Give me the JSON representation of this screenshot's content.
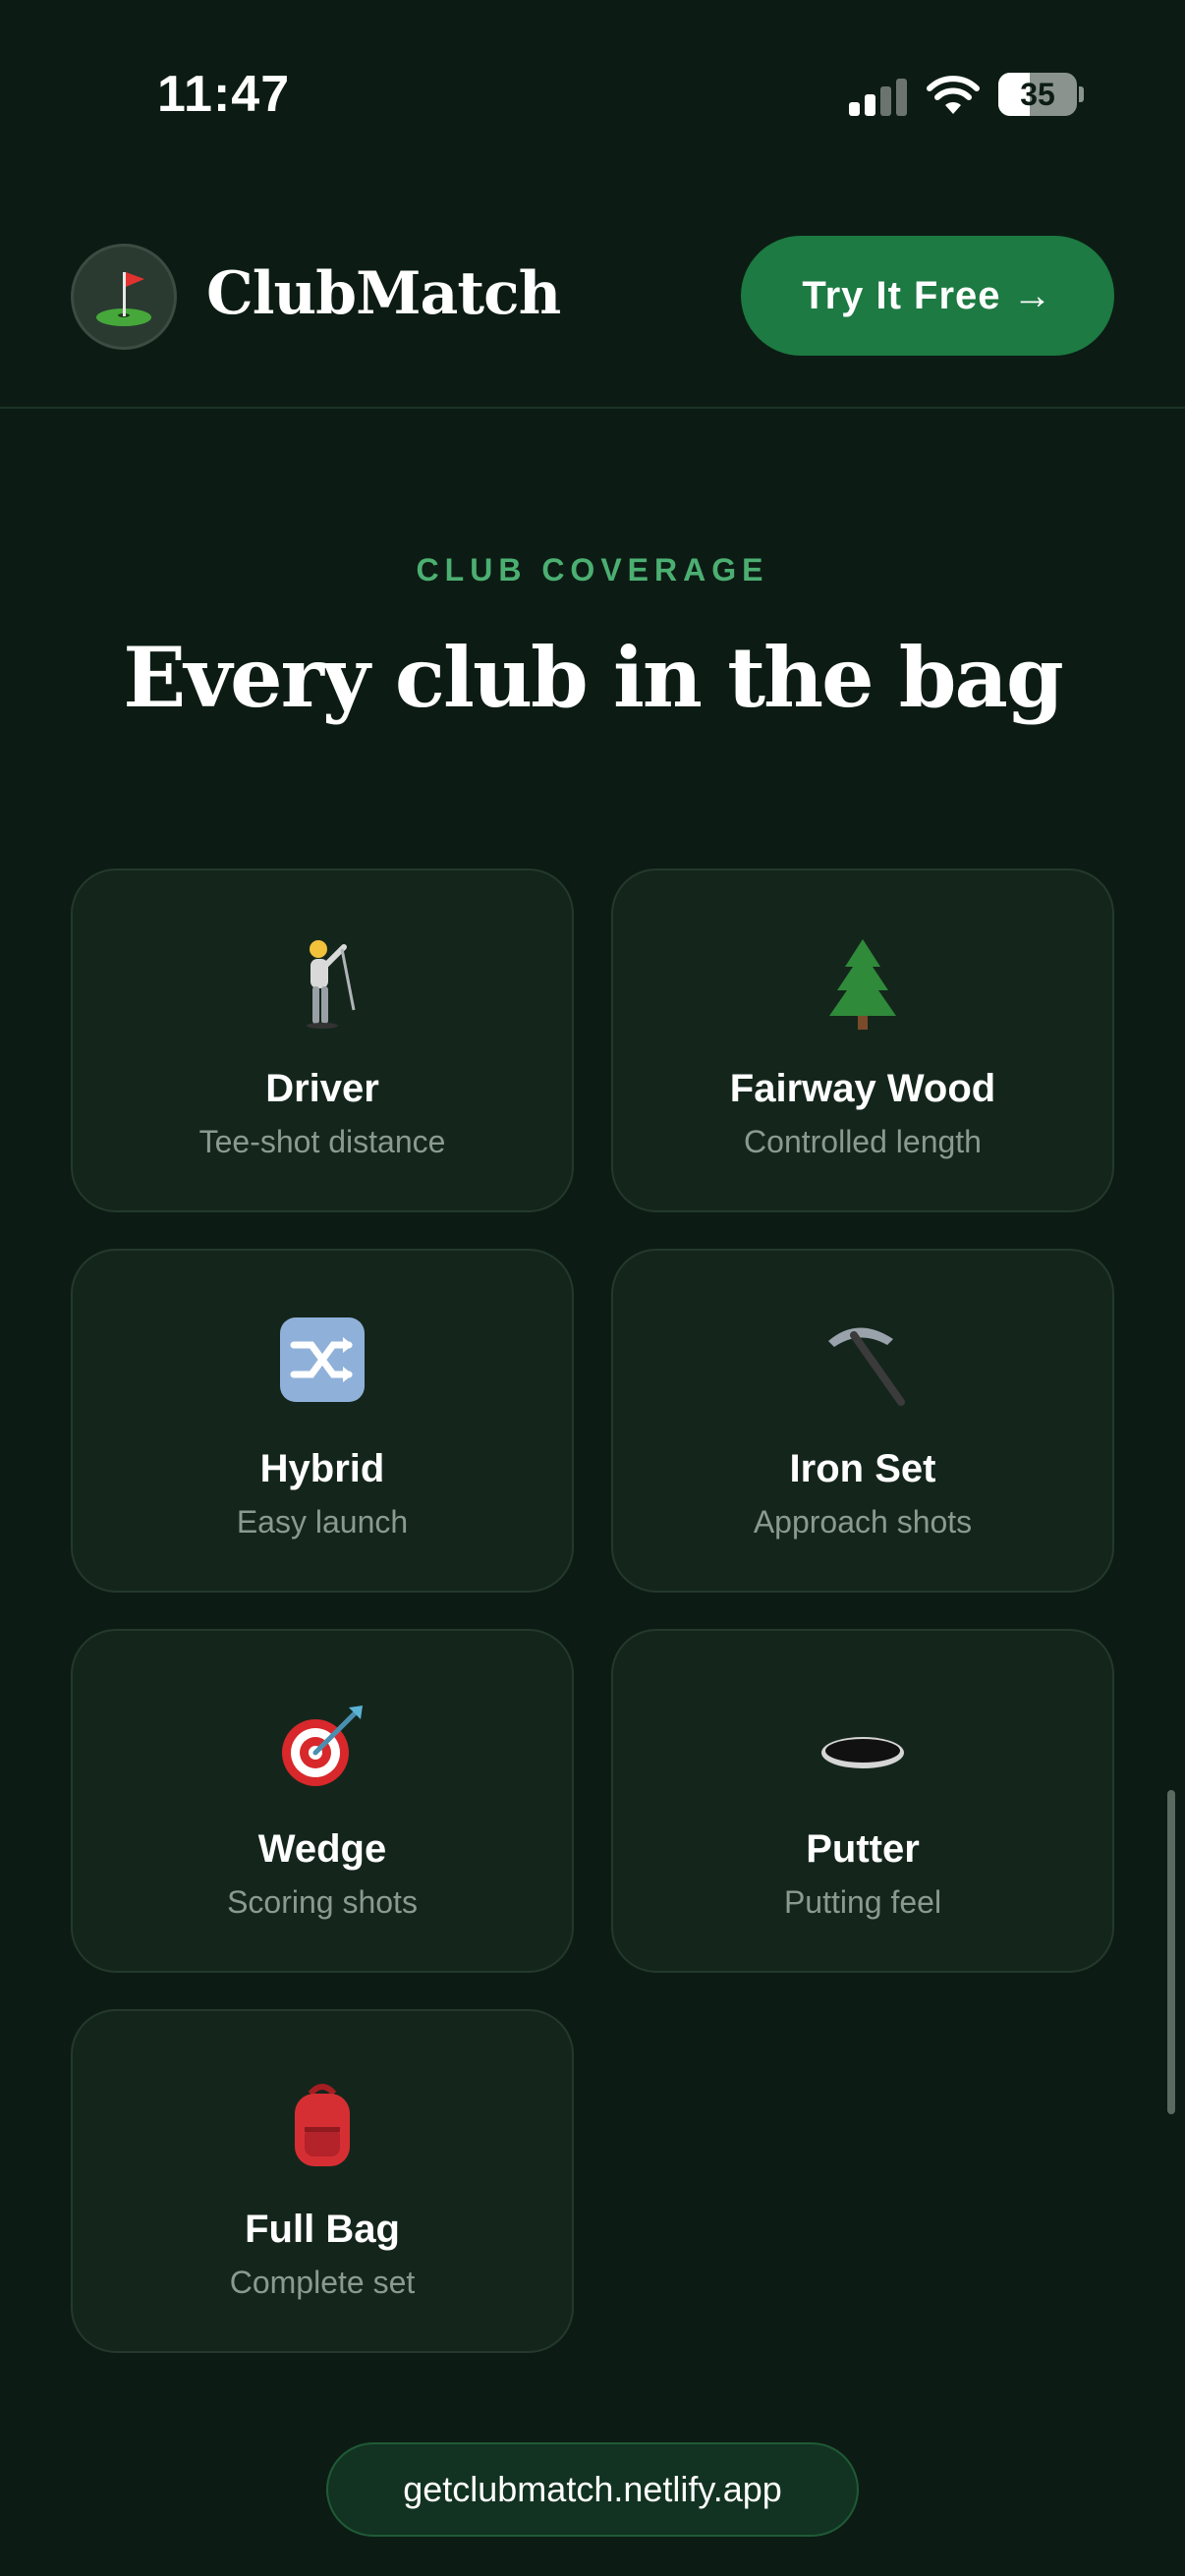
{
  "status_bar": {
    "time": "11:47",
    "battery": "35",
    "icons": [
      "signal-icon",
      "wifi-icon",
      "battery-icon"
    ]
  },
  "header": {
    "logo_icon": "golf-flag-icon",
    "brand": "ClubMatch",
    "cta_label": "Try It Free →"
  },
  "section": {
    "eyebrow": "CLUB COVERAGE",
    "title": "Every club in the bag"
  },
  "clubs": [
    {
      "icon": "golfer-icon",
      "title": "Driver",
      "subtitle": "Tee-shot distance"
    },
    {
      "icon": "evergreen-tree-icon",
      "title": "Fairway Wood",
      "subtitle": "Controlled length"
    },
    {
      "icon": "shuffle-icon",
      "title": "Hybrid",
      "subtitle": "Easy launch"
    },
    {
      "icon": "pickaxe-icon",
      "title": "Iron Set",
      "subtitle": "Approach shots"
    },
    {
      "icon": "bullseye-icon",
      "title": "Wedge",
      "subtitle": "Scoring shots"
    },
    {
      "icon": "hole-icon",
      "title": "Putter",
      "subtitle": "Putting feel"
    },
    {
      "icon": "backpack-icon",
      "title": "Full Bag",
      "subtitle": "Complete set"
    }
  ],
  "footer": {
    "url": "getclubmatch.netlify.app"
  },
  "colors": {
    "background": "#0c1c14",
    "accent": "#1c7a42",
    "eyebrow": "#4caf72",
    "card": "#14261c"
  }
}
